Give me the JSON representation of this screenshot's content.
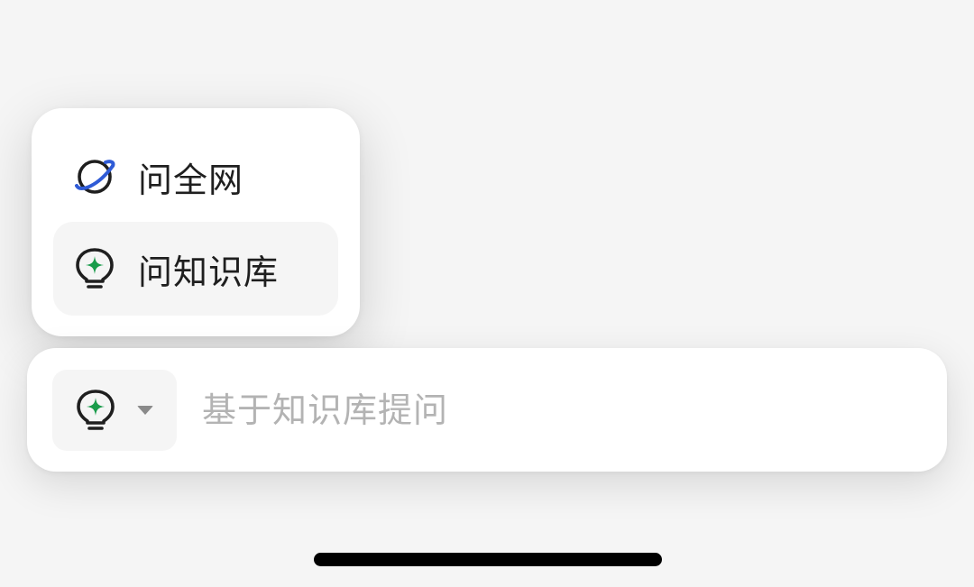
{
  "menu": {
    "items": [
      {
        "label": "问全网",
        "icon": "planet-icon",
        "selected": false
      },
      {
        "label": "问知识库",
        "icon": "lightbulb-sparkle-icon",
        "selected": true
      }
    ]
  },
  "input_bar": {
    "mode_icon": "lightbulb-sparkle-icon",
    "placeholder": "基于知识库提问",
    "value": ""
  },
  "colors": {
    "background": "#f5f5f5",
    "surface": "#ffffff",
    "selected_item_bg": "#f5f5f5",
    "planet_ring": "#2f5bd6",
    "sparkle_green": "#1a9c4b",
    "icon_stroke": "#1f1f1f",
    "placeholder_text": "#b3b3b3"
  }
}
